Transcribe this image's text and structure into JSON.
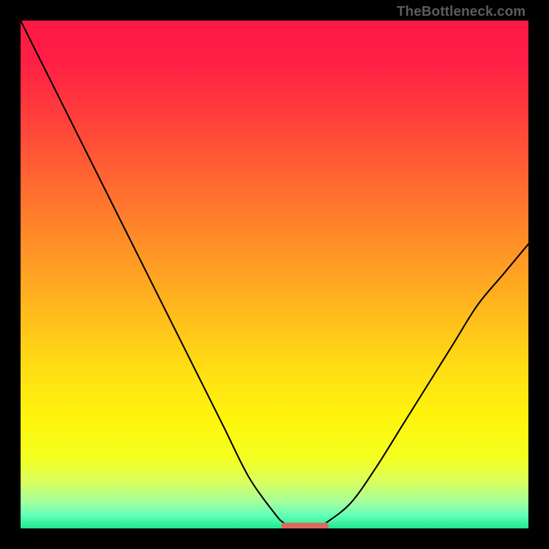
{
  "watermark": "TheBottleneck.com",
  "colors": {
    "frame": "#000000",
    "gradient_stops": [
      {
        "offset": 0.0,
        "color": "#ff1944"
      },
      {
        "offset": 0.08,
        "color": "#ff1f45"
      },
      {
        "offset": 0.18,
        "color": "#ff3c3c"
      },
      {
        "offset": 0.28,
        "color": "#ff5c34"
      },
      {
        "offset": 0.38,
        "color": "#ff7c2c"
      },
      {
        "offset": 0.48,
        "color": "#ff9c24"
      },
      {
        "offset": 0.58,
        "color": "#ffbc1c"
      },
      {
        "offset": 0.68,
        "color": "#ffdc14"
      },
      {
        "offset": 0.78,
        "color": "#fff40c"
      },
      {
        "offset": 0.86,
        "color": "#f4ff20"
      },
      {
        "offset": 0.91,
        "color": "#d8ff60"
      },
      {
        "offset": 0.95,
        "color": "#a0ffa0"
      },
      {
        "offset": 0.975,
        "color": "#60ffb8"
      },
      {
        "offset": 1.0,
        "color": "#20e88c"
      }
    ],
    "curve_stroke": "#000000",
    "flat_segment": "#d96a5f"
  },
  "chart_data": {
    "type": "line",
    "title": "",
    "xlabel": "",
    "ylabel": "",
    "xlim": [
      0,
      100
    ],
    "ylim": [
      0,
      100
    ],
    "grid": false,
    "series": [
      {
        "name": "bottleneck-curve",
        "x": [
          0,
          5,
          10,
          15,
          20,
          25,
          30,
          35,
          40,
          45,
          50,
          52,
          55,
          58,
          60,
          65,
          70,
          75,
          80,
          85,
          90,
          95,
          100
        ],
        "y": [
          100,
          90,
          80,
          70,
          60,
          50,
          40,
          30,
          20,
          10,
          3,
          1,
          0,
          0,
          1,
          5,
          12,
          20,
          28,
          36,
          44,
          50,
          56
        ]
      }
    ],
    "flat_segment": {
      "x_start": 52,
      "x_end": 60,
      "y": 0.5
    },
    "annotations": []
  }
}
